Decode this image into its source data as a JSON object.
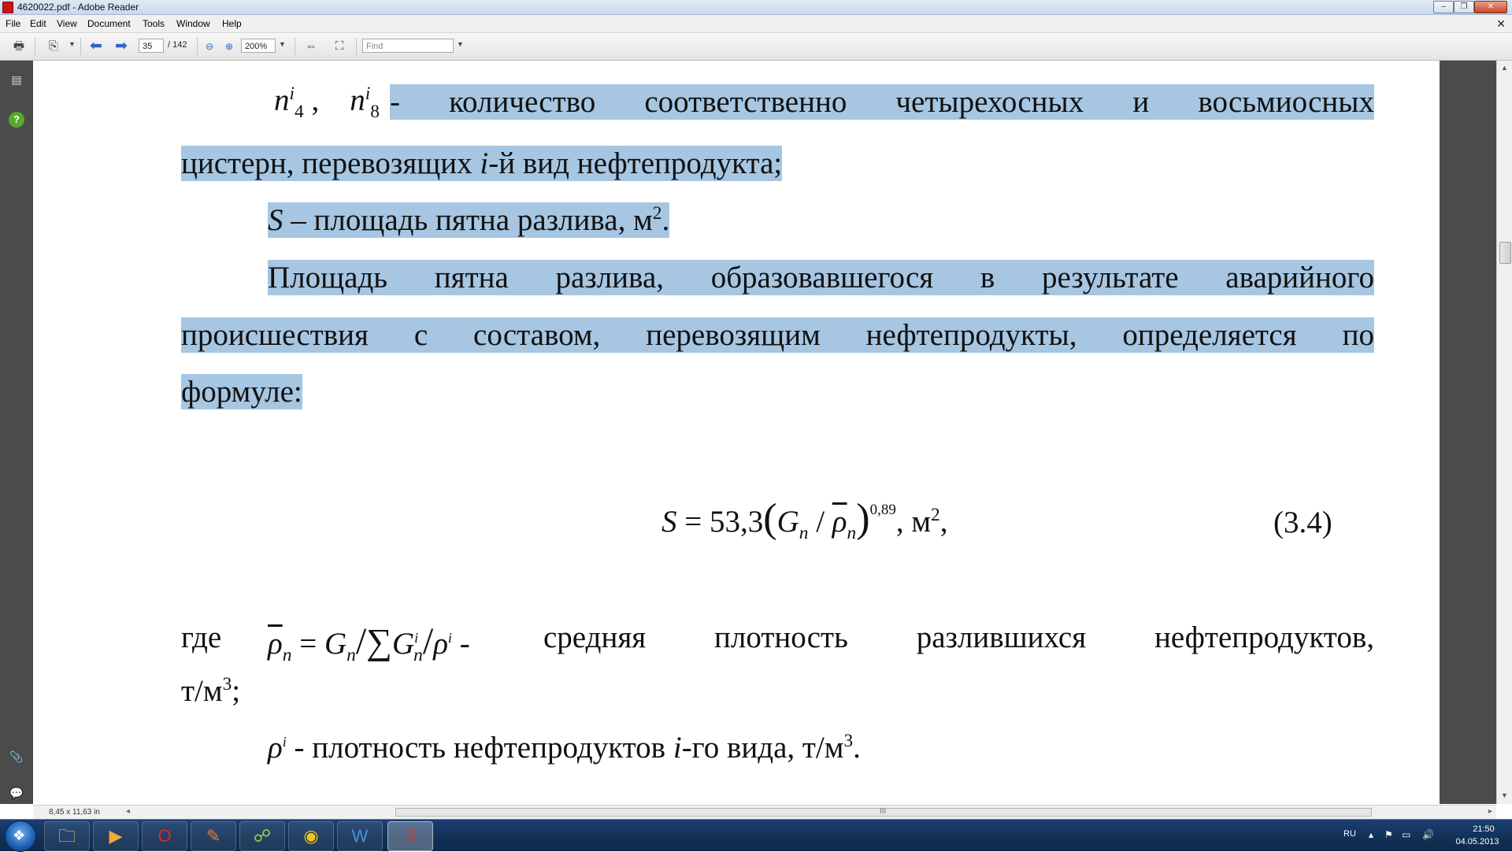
{
  "window": {
    "title": "4620022.pdf - Adobe Reader"
  },
  "menu": {
    "items": [
      "File",
      "Edit",
      "View",
      "Document",
      "Tools",
      "Window",
      "Help"
    ]
  },
  "toolbar": {
    "page_current": "35",
    "page_total": "/ 142",
    "zoom": "200%",
    "find_placeholder": "Find"
  },
  "document": {
    "l1_a": "n",
    "l1_a_sup": "i",
    "l1_a_sub": "4",
    "l1_comma": " ,",
    "l1_b": "n",
    "l1_b_sup": "i",
    "l1_b_sub": "8",
    "l1_words": [
      "-",
      "количество",
      "соответственно",
      "четырехосных",
      "и",
      "восьмиосных"
    ],
    "l2_pre": "цистерн, перевозящих ",
    "l2_i": "i",
    "l2_post": "-й вид нефтепродукта;",
    "l3_S": "S",
    "l3_text": " – площадь пятна разлива, м",
    "l3_sup": "2",
    "l3_end": ".",
    "l4_words": [
      "Площадь",
      "пятна",
      "разлива,",
      "образовавшегося",
      "в",
      "результате",
      "аварийного"
    ],
    "l5_words": [
      "происшествия",
      "с",
      "составом,",
      "перевозящим",
      "нефтепродукты,",
      "определяется",
      "по"
    ],
    "l6": "формуле:",
    "formula": {
      "S": "S",
      "eq": " = 53,3",
      "lp": "(",
      "G": "G",
      "G_sub": "n",
      "slash": " / ",
      "rho": "ρ",
      "rho_sub": "n",
      "rp": ")",
      "exp": "0,89",
      "unit": ", м",
      "unit_sup": "2",
      "end": ",",
      "number": "(3.4)"
    },
    "l8_gde": "где",
    "l8_rho": "ρ",
    "l8_rho_sub": "n",
    "l8_eq": " = ",
    "l8_G": "G",
    "l8_G_sub": "n",
    "l8_sl": "/",
    "l8_sum": "∑",
    "l8_G2": "G",
    "l8_G2_sub": "n",
    "l8_G2_sup": "i",
    "l8_sl2": "/",
    "l8_rho2": "ρ",
    "l8_rho2_sup": "i",
    "l8_dash": " -",
    "l8_words": [
      "средняя",
      "плотность",
      "разлившихся",
      "нефтепродуктов,"
    ],
    "l9": "т/м",
    "l9_sup": "3",
    "l9_end": ";",
    "l10_rho": "ρ",
    "l10_sup": "i",
    "l10_pre": "  - плотность нефтепродуктов ",
    "l10_i": "i",
    "l10_post": "-го вида, т/м",
    "l10_sup2": "3",
    "l10_end": "."
  },
  "status": {
    "page_size": "8,45 x 11,63 in"
  },
  "taskbar": {
    "lang": "RU",
    "time": "21:50",
    "date": "04.05.2013"
  },
  "colors": {
    "selection": "#a6c6e2",
    "nav_pane": "#4b4b4b"
  }
}
